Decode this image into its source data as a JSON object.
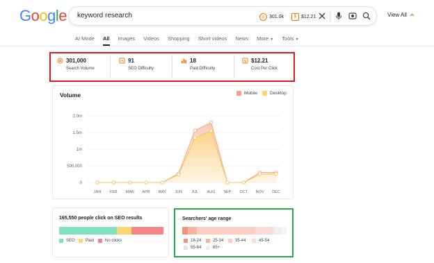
{
  "logo": {
    "text": "Google"
  },
  "search": {
    "query": "keyword research",
    "pill_volume": "301.0k",
    "pill_cpc": "$12.21",
    "view_all": "View All"
  },
  "tabs": [
    "AI Mode",
    "All",
    "Images",
    "Videos",
    "Shopping",
    "Short videos",
    "News",
    "More",
    "Tools"
  ],
  "metrics": [
    {
      "value": "301,000",
      "label": "Search Volume",
      "icon": "target-icon"
    },
    {
      "value": "91",
      "label": "SEO Difficulty",
      "icon": "gauge-icon"
    },
    {
      "value": "18",
      "label": "Paid Difficulty",
      "icon": "bar-chart-icon"
    },
    {
      "value": "$12.21",
      "label": "Cost Per Click",
      "icon": "dollar-icon"
    }
  ],
  "volume": {
    "title": "Volume",
    "legend": [
      {
        "name": "Mobile",
        "color": "#f4a27e"
      },
      {
        "name": "Desktop",
        "color": "#fbd66a"
      }
    ]
  },
  "chart_data": {
    "type": "area",
    "title": "Volume",
    "categories": [
      "JAN",
      "FEB",
      "MAR",
      "APR",
      "MAY",
      "JUN",
      "JUL",
      "AUG",
      "SEP",
      "OCT",
      "NOV",
      "DEC"
    ],
    "yticks": [
      "0",
      "500,000",
      "1m",
      "1.5m",
      "2.0m"
    ],
    "ylim": [
      0,
      2000000
    ],
    "series": [
      {
        "name": "Mobile",
        "color": "#f4a27e",
        "values": [
          0,
          0,
          0,
          0,
          0,
          270000,
          1560000,
          1800000,
          0,
          0,
          300000,
          300000
        ]
      },
      {
        "name": "Desktop",
        "color": "#fbd66a",
        "values": [
          0,
          0,
          0,
          0,
          0,
          240000,
          1340000,
          1550000,
          0,
          0,
          250000,
          260000
        ]
      }
    ]
  },
  "clicks": {
    "title": "165,550 people click on SEO results",
    "segments": [
      {
        "name": "SEO",
        "share": 0.55,
        "color": "#7fe0c0"
      },
      {
        "name": "Paid",
        "share": 0.14,
        "color": "#f8d775"
      },
      {
        "name": "No clicks",
        "share": 0.31,
        "color": "#f58585"
      }
    ]
  },
  "age": {
    "title": "Searchers' age range",
    "segments": [
      {
        "name": "18-24",
        "share": 0.05,
        "color": "#f0937a"
      },
      {
        "name": "25-34",
        "share": 0.09,
        "color": "#f4b49e"
      },
      {
        "name": "35-44",
        "share": 0.56,
        "color": "#f8cfc0"
      },
      {
        "name": "45-54",
        "share": 0.18,
        "color": "#fadcd2"
      },
      {
        "name": "55-64",
        "share": 0.07,
        "color": "#eeeeee"
      },
      {
        "name": "65+",
        "share": 0.05,
        "color": "#f5f5f5"
      }
    ]
  }
}
